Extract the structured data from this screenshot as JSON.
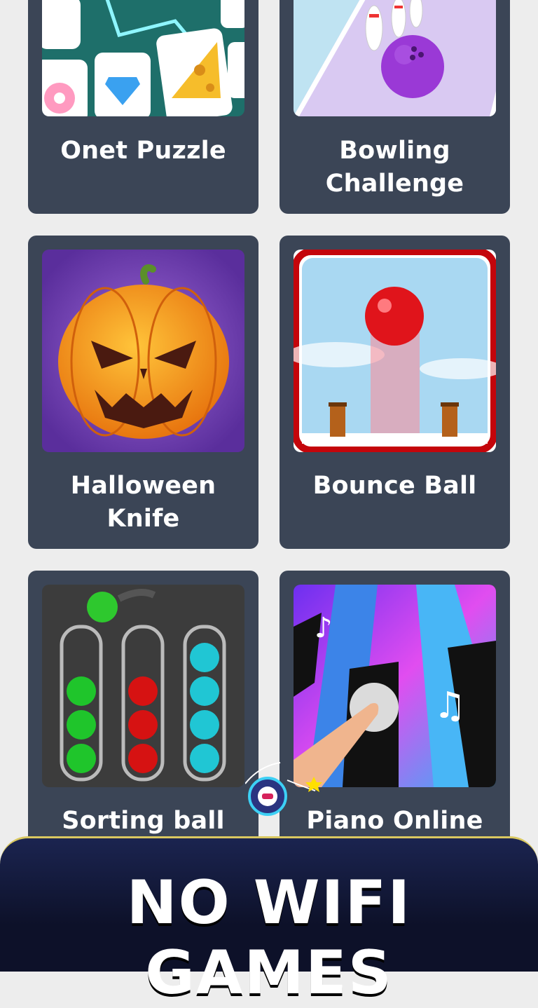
{
  "games": [
    {
      "title": "Onet Puzzle",
      "thumb_icon": "onet-puzzle-thumbnail"
    },
    {
      "title": "Bowling Challenge",
      "thumb_icon": "bowling-challenge-thumbnail"
    },
    {
      "title": "Halloween Knife",
      "thumb_icon": "halloween-knife-thumbnail"
    },
    {
      "title": "Bounce Ball",
      "thumb_icon": "bounce-ball-thumbnail"
    },
    {
      "title": "Sorting ball",
      "thumb_icon": "sorting-ball-thumbnail"
    },
    {
      "title": "Piano Online",
      "thumb_icon": "piano-online-thumbnail"
    }
  ],
  "banner": {
    "text": "NO WIFI GAMES"
  },
  "colors": {
    "card": "#3b4556",
    "background": "#ededed",
    "banner": "#0d1129"
  }
}
